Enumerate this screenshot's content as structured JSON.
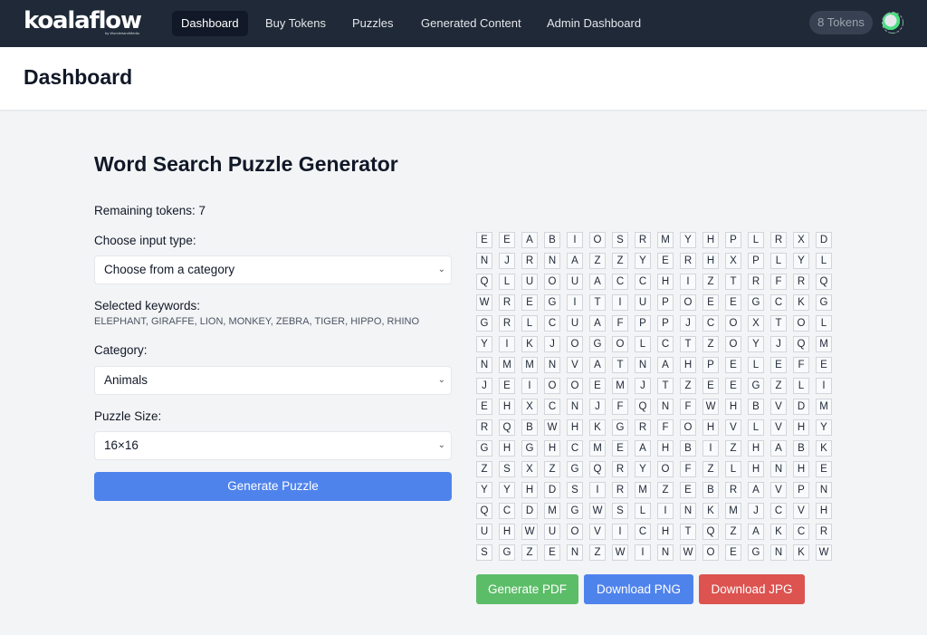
{
  "nav": {
    "brand": "koalaflow",
    "brand_sub": "by WonderlandMedia",
    "items": [
      {
        "label": "Dashboard",
        "active": true
      },
      {
        "label": "Buy Tokens",
        "active": false
      },
      {
        "label": "Puzzles",
        "active": false
      },
      {
        "label": "Generated Content",
        "active": false
      },
      {
        "label": "Admin Dashboard",
        "active": false
      }
    ],
    "tokens": "8 Tokens"
  },
  "header": {
    "title": "Dashboard"
  },
  "generator": {
    "title": "Word Search Puzzle Generator",
    "remaining_tokens": "Remaining tokens: 7",
    "input_type_label": "Choose input type:",
    "input_type_value": "Choose from a category",
    "keywords_label": "Selected keywords:",
    "keywords": "ELEPHANT, GIRAFFE, LION, MONKEY, ZEBRA, TIGER, HIPPO, RHINO",
    "category_label": "Category:",
    "category_value": "Animals",
    "size_label": "Puzzle Size:",
    "size_value": "16×16",
    "generate_button": "Generate Puzzle"
  },
  "grid": [
    "EEABIOSRMYHPLRXD",
    "NJRNAZZYERHXPLYL",
    "QLUOUACCHIZTRFRQ",
    "WREGITIUPOEEGCKG",
    "GRLCUAFPPJCOXTOL",
    "YIKJOGOLCTZOYJQM",
    "NMMNVATNAHPELEFE",
    "JEIOOEMJTZEEGZLI",
    "EHXCNJFQNFWHBVDM",
    "RQBWHKGRFOHVLVHY",
    "GHGHCMEAHBIZHABK",
    "ZSXZGQRYOFZLHNHE",
    "YYHDSIRMZEBRAVPN",
    "QCDMGWSLINKMJCVH",
    "UHWUOVICHTQZAKCR",
    "SGZENZWINWOEGNKW"
  ],
  "actions": {
    "pdf": "Generate PDF",
    "png": "Download PNG",
    "jpg": "Download JPG"
  }
}
